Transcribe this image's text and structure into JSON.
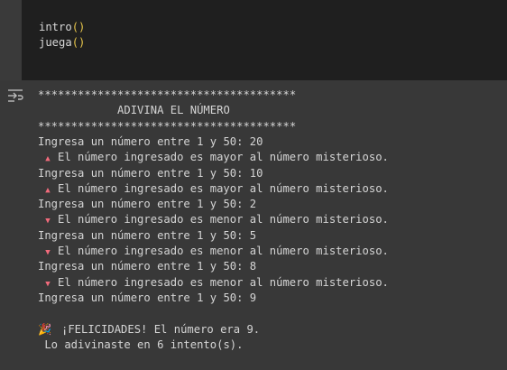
{
  "code": {
    "lines": [
      {
        "name": "intro",
        "paren": "()"
      },
      {
        "name": "juega",
        "paren": "()"
      }
    ]
  },
  "output": {
    "icon": "output-toggle-icon",
    "lines": [
      {
        "text": "***************************************"
      },
      {
        "text": "            ADIVINA EL NÚMERO"
      },
      {
        "text": "***************************************"
      },
      {
        "text": "Ingresa un número entre 1 y 50: 20"
      },
      {
        "marker": "▲",
        "text": "El número ingresado es mayor al número misterioso."
      },
      {
        "text": "Ingresa un número entre 1 y 50: 10"
      },
      {
        "marker": "▲",
        "text": "El número ingresado es mayor al número misterioso."
      },
      {
        "text": "Ingresa un número entre 1 y 50: 2"
      },
      {
        "marker": "▼",
        "text": "El número ingresado es menor al número misterioso."
      },
      {
        "text": "Ingresa un número entre 1 y 50: 5"
      },
      {
        "marker": "▼",
        "text": "El número ingresado es menor al número misterioso."
      },
      {
        "text": "Ingresa un número entre 1 y 50: 8"
      },
      {
        "marker": "▼",
        "text": "El número ingresado es menor al número misterioso."
      },
      {
        "text": "Ingresa un número entre 1 y 50: 9"
      },
      {
        "text": ""
      },
      {
        "marker": "🎉",
        "text": "¡FELICIDADES! El número era 9."
      },
      {
        "text": " Lo adivinaste en 6 intento(s)."
      }
    ]
  }
}
